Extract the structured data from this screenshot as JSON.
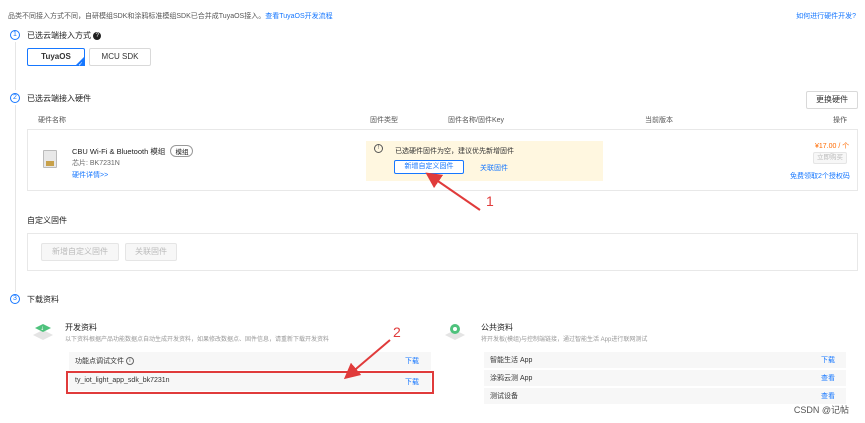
{
  "top": {
    "notice": "品类不同接入方式不同，自研模组SDK和涂鸦标准模组SDK已合并成TuyaOS接入。",
    "notice_link": "查看TuyaOS开发流程",
    "how_link": "如何进行硬件开发?"
  },
  "step1": {
    "num": "1",
    "title": "已选云端接入方式",
    "help_icon": "?",
    "options": [
      "TuyaOS",
      "MCU SDK"
    ]
  },
  "step2": {
    "num": "2",
    "title": "已选云端接入硬件",
    "change_button": "更换硬件",
    "columns": [
      "硬件名称",
      "固件类型",
      "固件名称/固件Key",
      "当前版本",
      "操作"
    ],
    "module": {
      "name": "CBU Wi-Fi & Bluetooth 模组",
      "tag": "模组",
      "chip": "芯片: BK7231N",
      "details": "硬件详情>>"
    },
    "warning": {
      "icon": "!",
      "text": "已选硬件固件为空，建议优先新增固件",
      "new_fw": "新增自定义固件",
      "link_fw": "关联固件"
    },
    "price": "¥17.00 / 个",
    "buy_button": "立即购买",
    "free_link": "免费领取2个授权码"
  },
  "custom_fw": {
    "title": "自定义固件",
    "new_fw": "新增自定义固件",
    "link_fw": "关联固件"
  },
  "step3": {
    "num": "3",
    "title": "下载资料",
    "dev": {
      "title": "开发资料",
      "desc": "以下资料根据产品功能数据点自动生成开发资料，如果修改数据点、固件信息，请重新下载开发资料",
      "rows": [
        {
          "label": "功能点调试文件",
          "action": "下载"
        },
        {
          "label": "ty_iot_light_app_sdk_bk7231n",
          "action": "下载"
        }
      ]
    },
    "public": {
      "title": "公共资料",
      "desc": "将开发板(模组)与控制端链接，通过智能生活 App进行联网测试",
      "rows": [
        {
          "label": "智能生活 App",
          "action": "下载"
        },
        {
          "label": "涂鸦云测 App",
          "action": "查看"
        },
        {
          "label": "测试设备",
          "action": "查看"
        }
      ]
    }
  },
  "annotations": {
    "label1": "1",
    "label2": "2"
  },
  "watermark": "CSDN @记帖",
  "colors": {
    "accent": "#1677ff",
    "warn_bg": "#fff7e0",
    "annotation": "#e03b3b",
    "price": "#ff6a00"
  }
}
